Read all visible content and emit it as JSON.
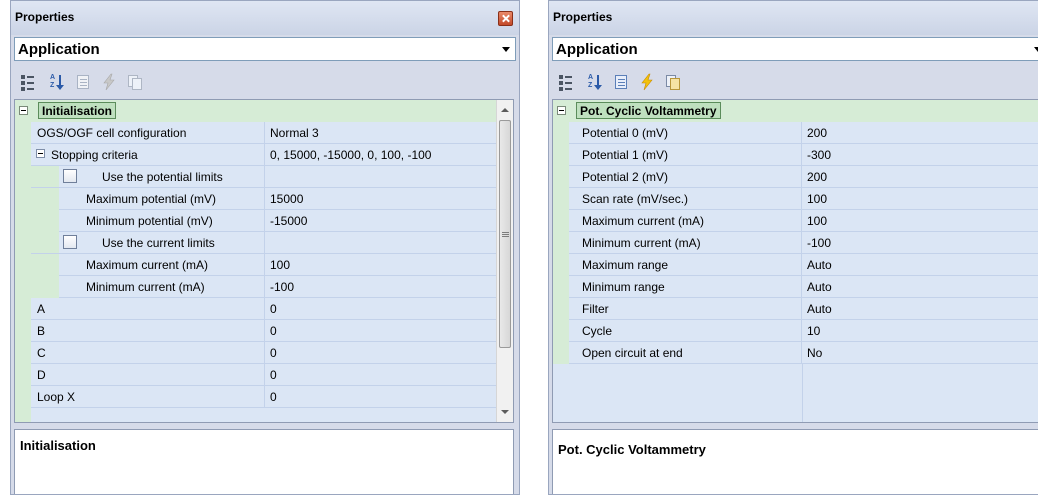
{
  "colors": {
    "category": "#d6ecd6",
    "row": "#dbe6f5",
    "frame": "#d6dbe9"
  },
  "left": {
    "title": "Properties",
    "object": "Application",
    "category": "Initialisation",
    "rows": [
      {
        "name": "OGS/OGF cell configuration",
        "value": "Normal 3"
      },
      {
        "name": "Stopping criteria",
        "value": "0, 15000, -15000, 0, 100, -100"
      },
      {
        "name": "Use the potential limits",
        "value": ""
      },
      {
        "name": "Maximum potential (mV)",
        "value": "15000"
      },
      {
        "name": "Minimum potential (mV)",
        "value": "-15000"
      },
      {
        "name": "Use the current limits",
        "value": ""
      },
      {
        "name": "Maximum current (mA)",
        "value": "100"
      },
      {
        "name": "Minimum current (mA)",
        "value": "-100"
      },
      {
        "name": "A",
        "value": "0"
      },
      {
        "name": "B",
        "value": "0"
      },
      {
        "name": "C",
        "value": "0"
      },
      {
        "name": "D",
        "value": "0"
      },
      {
        "name": "Loop X",
        "value": "0"
      }
    ],
    "description": "Initialisation"
  },
  "right": {
    "title": "Properties",
    "object": "Application",
    "category": "Pot. Cyclic Voltammetry",
    "rows": [
      {
        "name": "Potential 0 (mV)",
        "value": "200"
      },
      {
        "name": "Potential 1 (mV)",
        "value": "-300"
      },
      {
        "name": "Potential 2 (mV)",
        "value": "200"
      },
      {
        "name": "Scan rate (mV/sec.)",
        "value": "100"
      },
      {
        "name": "Maximum current (mA)",
        "value": "100"
      },
      {
        "name": "Minimum current (mA)",
        "value": "-100"
      },
      {
        "name": "Maximum range",
        "value": "Auto"
      },
      {
        "name": "Minimum range",
        "value": "Auto"
      },
      {
        "name": "Filter",
        "value": "Auto"
      },
      {
        "name": "Cycle",
        "value": "10"
      },
      {
        "name": "Open circuit at end",
        "value": "No"
      }
    ],
    "description": "Pot. Cyclic Voltammetry"
  }
}
